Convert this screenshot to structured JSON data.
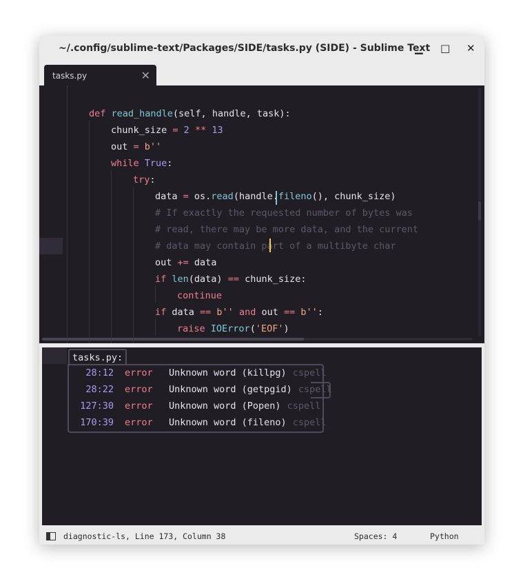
{
  "window": {
    "title": "~/.config/sublime-text/Packages/SIDE/tasks.py (SIDE) - Sublime Text",
    "minimize_glyph": "▁",
    "maximize_glyph": "□",
    "close_glyph": "✕"
  },
  "tab": {
    "label": "tasks.py",
    "close_glyph": "✕"
  },
  "editor": {
    "lines": [
      [
        {
          "t": "def ",
          "c": "k"
        },
        {
          "t": "read_handle",
          "c": "f"
        },
        {
          "t": "(self, handle, task):",
          "c": ""
        }
      ],
      [
        {
          "t": "chunk_size ",
          "c": ""
        },
        {
          "t": "= ",
          "c": "k"
        },
        {
          "t": "2 ",
          "c": "n"
        },
        {
          "t": "** ",
          "c": "k"
        },
        {
          "t": "13",
          "c": "n"
        }
      ],
      [
        {
          "t": "out ",
          "c": ""
        },
        {
          "t": "= ",
          "c": "k"
        },
        {
          "t": "b''",
          "c": "s"
        }
      ],
      [
        {
          "t": "while ",
          "c": "k"
        },
        {
          "t": "True",
          "c": "n"
        },
        {
          "t": ":",
          "c": ""
        }
      ],
      [
        {
          "t": "try",
          "c": "k"
        },
        {
          "t": ":",
          "c": ""
        }
      ],
      [
        {
          "t": "data ",
          "c": ""
        },
        {
          "t": "= ",
          "c": "k"
        },
        {
          "t": "os.",
          "c": ""
        },
        {
          "t": "read",
          "c": "f"
        },
        {
          "t": "(handle.",
          "c": ""
        },
        {
          "t": "fileno",
          "c": "f"
        },
        {
          "t": "(), chunk_size)",
          "c": ""
        }
      ],
      [
        {
          "t": "# If exactly the requested number of bytes was",
          "c": "c"
        }
      ],
      [
        {
          "t": "# read, there may be more data, and the current",
          "c": "c"
        }
      ],
      [
        {
          "t": "# data may contain part of a multibyte char",
          "c": "c"
        }
      ],
      [
        {
          "t": "out ",
          "c": ""
        },
        {
          "t": "+= ",
          "c": "k"
        },
        {
          "t": "data",
          "c": ""
        }
      ],
      [
        {
          "t": "if ",
          "c": "k"
        },
        {
          "t": "len",
          "c": "f"
        },
        {
          "t": "(data) ",
          "c": ""
        },
        {
          "t": "== ",
          "c": "k"
        },
        {
          "t": "chunk_size:",
          "c": ""
        }
      ],
      [
        {
          "t": "continue",
          "c": "k"
        }
      ],
      [
        {
          "t": "if ",
          "c": "k"
        },
        {
          "t": "data ",
          "c": ""
        },
        {
          "t": "== ",
          "c": "k"
        },
        {
          "t": "b'' ",
          "c": "s"
        },
        {
          "t": "and ",
          "c": "k"
        },
        {
          "t": "out ",
          "c": ""
        },
        {
          "t": "== ",
          "c": "k"
        },
        {
          "t": "b''",
          "c": "s"
        },
        {
          "t": ":",
          "c": ""
        }
      ],
      [
        {
          "t": "raise ",
          "c": "k"
        },
        {
          "t": "IOError",
          "c": "f"
        },
        {
          "t": "(",
          "c": ""
        },
        {
          "t": "'EOF'",
          "c": "s"
        },
        {
          "t": ")",
          "c": ""
        }
      ]
    ]
  },
  "diagnostics": {
    "file_label": "tasks.py:",
    "rows": [
      {
        "loc": "28:12",
        "severity": "error",
        "message": "Unknown word (killpg)",
        "source": "cspell"
      },
      {
        "loc": "28:22",
        "severity": "error",
        "message": "Unknown word (getpgid)",
        "source": "cspell"
      },
      {
        "loc": "127:30",
        "severity": "error",
        "message": "Unknown word (Popen)",
        "source": "cspell"
      },
      {
        "loc": "170:39",
        "severity": "error",
        "message": "Unknown word (fileno)",
        "source": "cspell"
      }
    ]
  },
  "status": {
    "left": "diagnostic-ls, Line 173, Column 38",
    "spaces": "Spaces: 4",
    "syntax": "Python"
  },
  "colors": {
    "background": "#211d25",
    "keyword": "#ee7f8e",
    "function": "#7ec9d4",
    "number": "#a99cf0",
    "string": "#f2a883",
    "comment": "#5d5866",
    "caret": "#f5d547"
  }
}
